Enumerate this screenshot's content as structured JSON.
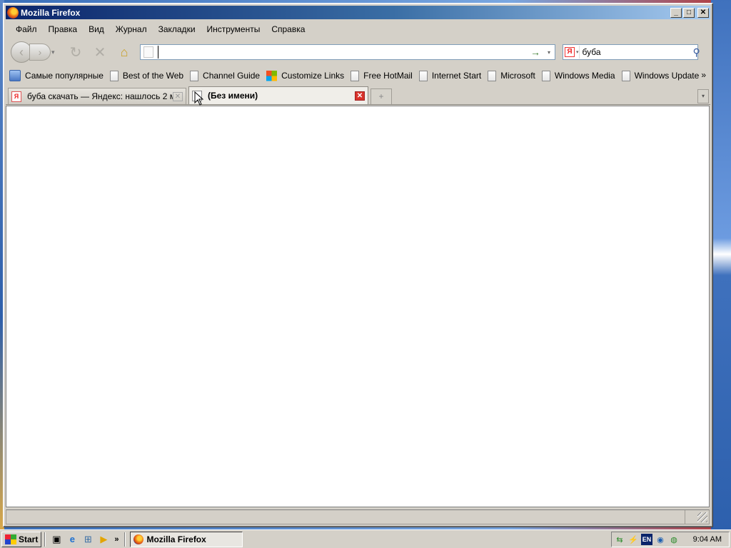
{
  "window": {
    "title": "Mozilla Firefox",
    "minimize": "_",
    "maximize": "□",
    "close": "✕"
  },
  "menu": [
    "Файл",
    "Правка",
    "Вид",
    "Журнал",
    "Закладки",
    "Инструменты",
    "Справка"
  ],
  "navbar": {
    "back": "‹",
    "forward": "›",
    "history": "▾",
    "reload": "↻",
    "stop": "✕",
    "home": "⌂",
    "url_value": "",
    "go": "→",
    "url_dropdown": "▾",
    "search_engine_logo": "Я",
    "search_engine_dropdown": "▾",
    "search_value": "буба",
    "search_go": "⚲"
  },
  "bookmarks": {
    "items": [
      {
        "label": "Самые популярные",
        "icon": "smart-folder-icon"
      },
      {
        "label": "Best of the Web",
        "icon": "page-icon"
      },
      {
        "label": "Channel Guide",
        "icon": "page-icon"
      },
      {
        "label": "Customize Links",
        "icon": "windows-logo-icon"
      },
      {
        "label": "Free HotMail",
        "icon": "page-icon"
      },
      {
        "label": "Internet Start",
        "icon": "page-icon"
      },
      {
        "label": "Microsoft",
        "icon": "page-icon"
      },
      {
        "label": "Windows Media",
        "icon": "page-icon"
      },
      {
        "label": "Windows Update",
        "icon": "page-icon"
      }
    ],
    "more": "»"
  },
  "tabs": [
    {
      "label": "буба скачать — Яндекс: нашлось 2 м...",
      "favicon": "Я",
      "close": "✕",
      "selected": false
    },
    {
      "label": "(Без имени)",
      "favicon": "",
      "close": "✕",
      "selected": true
    }
  ],
  "new_tab": "+",
  "tab_list": "▾",
  "status": {
    "text": ""
  },
  "taskbar": {
    "start_label": "Start",
    "quick_launch": [
      "desktop-icon",
      "ie-icon",
      "network-icon",
      "media-player-icon"
    ],
    "ql_more": "»",
    "task_label": "Mozilla Firefox",
    "tray_lang": "EN",
    "clock": "9:04 AM"
  }
}
